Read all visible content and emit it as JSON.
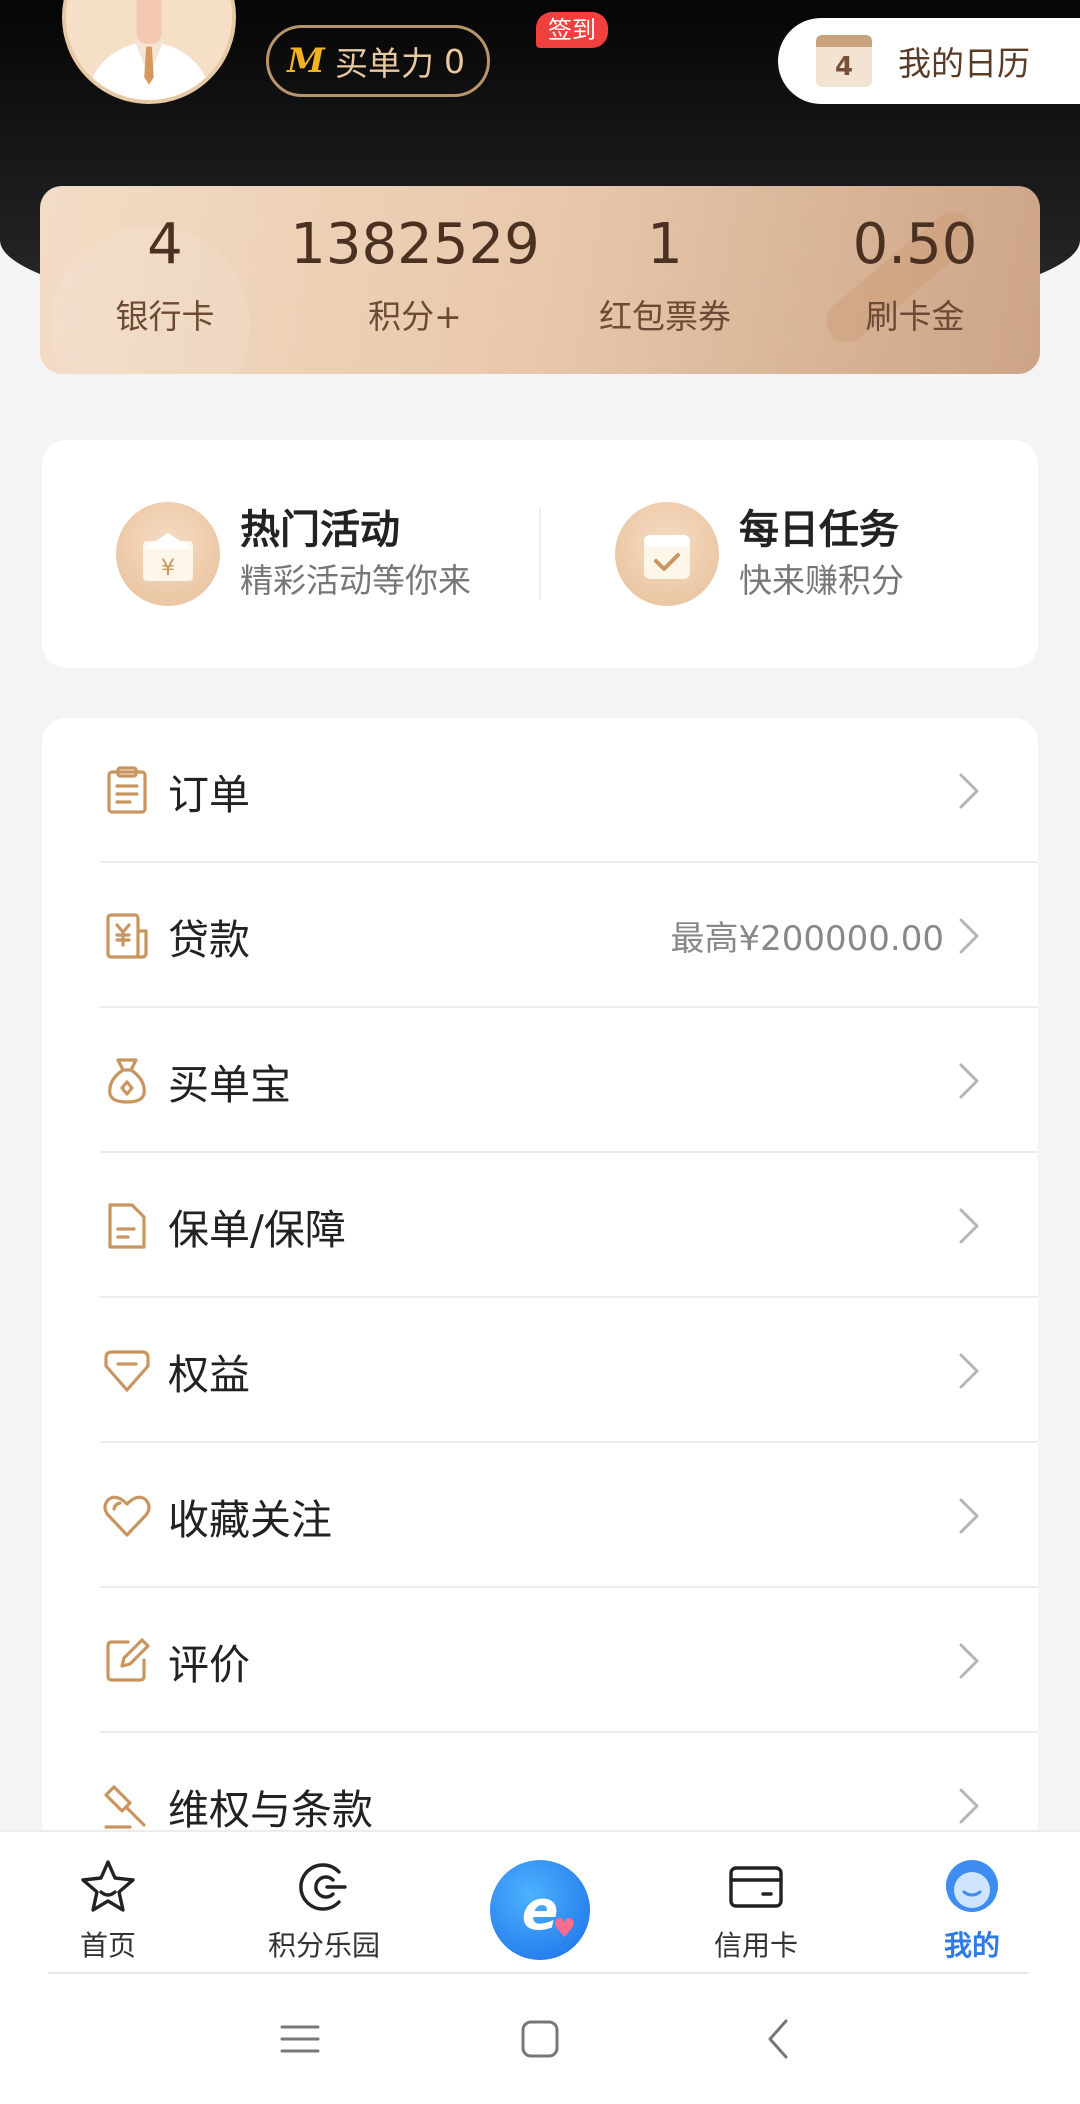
{
  "header": {
    "buy_power_label": "买单力",
    "buy_power_value": "0",
    "calendar_day": "4",
    "calendar_label": "我的日历"
  },
  "stats": [
    {
      "value": "4",
      "label": "银行卡"
    },
    {
      "value": "1382529",
      "label": "积分+"
    },
    {
      "value": "1",
      "label": "红包票券"
    },
    {
      "value": "0.50",
      "label": "刷卡金"
    }
  ],
  "activities": [
    {
      "title": "热门活动",
      "subtitle": "精彩活动等你来",
      "icon": "gift-box-icon"
    },
    {
      "title": "每日任务",
      "subtitle": "快来赚积分",
      "icon": "calendar-check-icon"
    }
  ],
  "menu": [
    {
      "label": "订单",
      "extra": "",
      "icon": "clipboard-icon"
    },
    {
      "label": "贷款",
      "extra": "最高¥200000.00",
      "icon": "yuan-doc-icon"
    },
    {
      "label": "买单宝",
      "extra": "",
      "icon": "money-bag-icon"
    },
    {
      "label": "保单/保障",
      "extra": "",
      "icon": "document-icon"
    },
    {
      "label": "权益",
      "extra": "",
      "icon": "diamond-icon"
    },
    {
      "label": "收藏关注",
      "extra": "",
      "icon": "heart-icon"
    },
    {
      "label": "评价",
      "extra": "",
      "icon": "edit-icon"
    },
    {
      "label": "维权与条款",
      "extra": "",
      "icon": "gavel-icon"
    }
  ],
  "bottom_nav": [
    {
      "label": "首页",
      "icon": "star-icon",
      "active": false
    },
    {
      "label": "积分乐园",
      "icon": "points-icon",
      "active": false
    },
    {
      "label": "",
      "icon": "checkin-icon",
      "badge": "签到",
      "active": false
    },
    {
      "label": "信用卡",
      "icon": "credit-card-icon",
      "active": false
    },
    {
      "label": "我的",
      "icon": "profile-icon",
      "active": true
    }
  ],
  "colors": {
    "accent_gold": "#c9955f",
    "active_blue": "#2f7ae5",
    "badge_red": "#f1413e"
  }
}
